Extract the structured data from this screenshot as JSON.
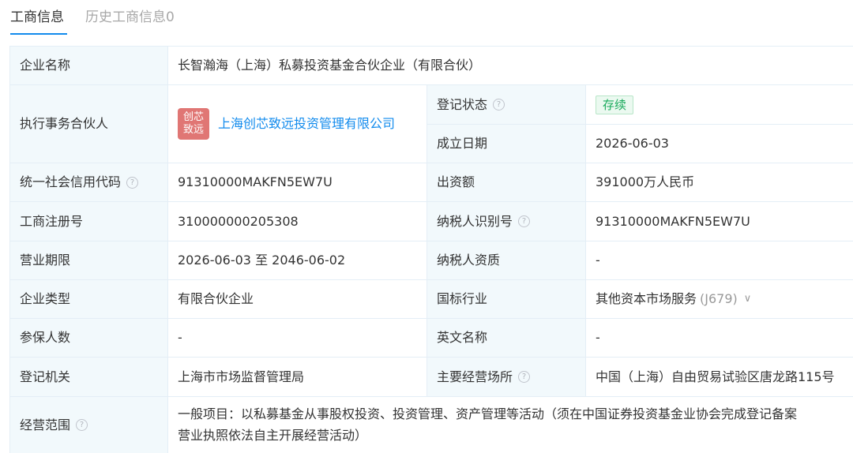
{
  "tabs": {
    "current": "工商信息",
    "history": "历史工商信息0"
  },
  "fields": {
    "company_name": {
      "label": "企业名称",
      "value": "长智瀚海（上海）私募投资基金合伙企业（有限合伙）"
    },
    "managing_partner": {
      "label": "执行事务合伙人",
      "logo_line1": "创芯",
      "logo_line2": "致远",
      "value": "上海创芯致远投资管理有限公司"
    },
    "reg_status": {
      "label": "登记状态",
      "value": "存续"
    },
    "est_date": {
      "label": "成立日期",
      "value": "2026-06-03"
    },
    "credit_code": {
      "label": "统一社会信用代码",
      "value": "91310000MAKFN5EW7U"
    },
    "capital": {
      "label": "出资额",
      "value": "391000万人民币"
    },
    "reg_no": {
      "label": "工商注册号",
      "value": "310000000205308"
    },
    "taxpayer_id": {
      "label": "纳税人识别号",
      "value": "91310000MAKFN5EW7U"
    },
    "term": {
      "label": "营业期限",
      "value": "2026-06-03 至 2046-06-02"
    },
    "taxpayer_qual": {
      "label": "纳税人资质",
      "value": "-"
    },
    "company_type": {
      "label": "企业类型",
      "value": "有限合伙企业"
    },
    "industry": {
      "label": "国标行业",
      "value": "其他资本市场服务",
      "code": "(J679)"
    },
    "insured": {
      "label": "参保人数",
      "value": "-"
    },
    "english_name": {
      "label": "英文名称",
      "value": "-"
    },
    "authority": {
      "label": "登记机关",
      "value": "上海市市场监督管理局"
    },
    "address": {
      "label": "主要经营场所",
      "value": "中国（上海）自由贸易试验区唐龙路115号"
    },
    "scope": {
      "label": "经营范围",
      "line1": "一般项目：以私募基金从事股权投资、投资管理、资产管理等活动（须在中国证券投资基金业协会完成登记备案",
      "line2": "营业执照依法自主开展经营活动）"
    }
  },
  "icons": {
    "help": "question-circle-icon",
    "chevron": "chevron-down-icon"
  }
}
